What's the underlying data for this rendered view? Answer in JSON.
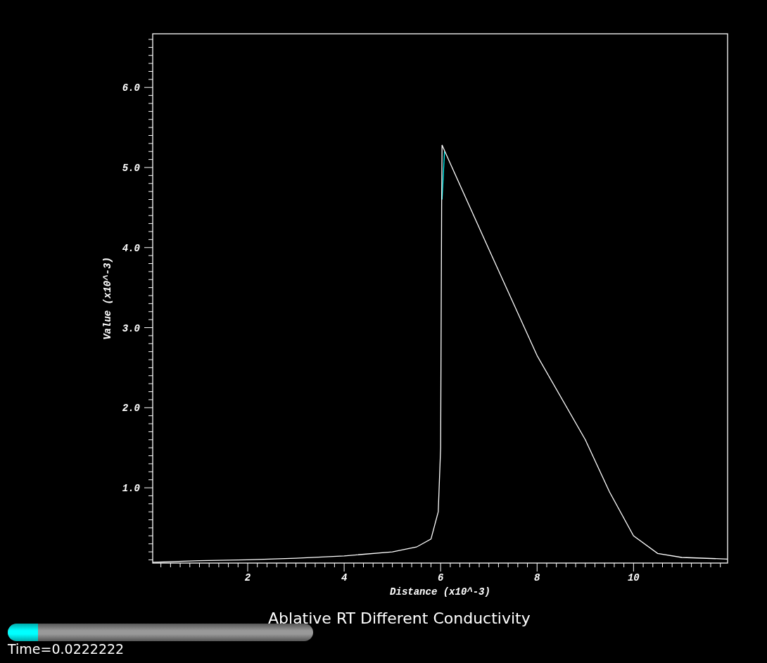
{
  "plot": {
    "chart_data": {
      "type": "line",
      "xlabel": "Distance (x10^-3)",
      "ylabel": "Value (x10^-3)",
      "xlim": [
        0.03,
        11.95
      ],
      "ylim": [
        0.06,
        6.67
      ],
      "xticks": [
        2,
        4,
        6,
        8,
        10
      ],
      "yticks": [
        {
          "value": 1,
          "label": "1.0"
        },
        {
          "value": 2,
          "label": "2.0"
        },
        {
          "value": 3,
          "label": "3.0"
        },
        {
          "value": 4,
          "label": "4.0"
        },
        {
          "value": 5,
          "label": "5.0"
        },
        {
          "value": 6,
          "label": "6.0"
        }
      ],
      "x": [
        0.03,
        1,
        2,
        3,
        4,
        5,
        5.5,
        5.8,
        5.95,
        6.0,
        6.02,
        6.03,
        6.08,
        7,
        8,
        9,
        9.5,
        10,
        10.5,
        11,
        11.95
      ],
      "series": [
        {
          "color": "#00ffff",
          "values": [
            null,
            null,
            null,
            null,
            null,
            null,
            null,
            null,
            null,
            null,
            null,
            4.6,
            5.2,
            null,
            null,
            null,
            null,
            null,
            null,
            null,
            null
          ]
        },
        {
          "color": "#ffffff",
          "values": [
            0.07,
            0.09,
            0.1,
            0.12,
            0.15,
            0.2,
            0.26,
            0.36,
            0.7,
            1.5,
            4.5,
            5.28,
            5.21,
            3.98,
            2.65,
            1.6,
            0.95,
            0.4,
            0.18,
            0.13,
            0.11
          ]
        }
      ]
    }
  },
  "title": "Ablative RT Different Conductivity",
  "time_slider": {
    "level": 0.1
  },
  "time_label": "Time=0.0222222"
}
